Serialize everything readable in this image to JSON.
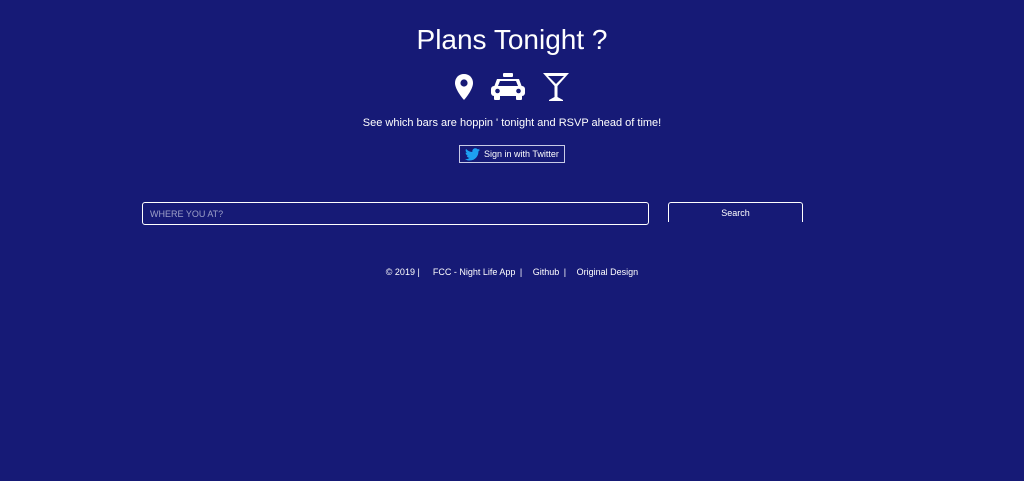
{
  "header": {
    "title": "Plans Tonight ?",
    "icons": [
      "map-marker-icon",
      "taxi-icon",
      "cocktail-icon"
    ],
    "tagline": "See which bars are hoppin ' tonight and RSVP ahead of time!"
  },
  "auth": {
    "twitter_label": "Sign in with Twitter"
  },
  "search": {
    "placeholder": "WHERE YOU AT?",
    "value": "",
    "button_label": "Search"
  },
  "footer": {
    "copyright": "© 2019 |",
    "links": [
      {
        "label": "FCC - Night Life App",
        "sep": "|"
      },
      {
        "label": "Github",
        "sep": "|"
      },
      {
        "label": "Original Design",
        "sep": ""
      }
    ]
  },
  "colors": {
    "background": "#161a76",
    "text": "#ffffff",
    "twitter_blue": "#1da1f2"
  }
}
